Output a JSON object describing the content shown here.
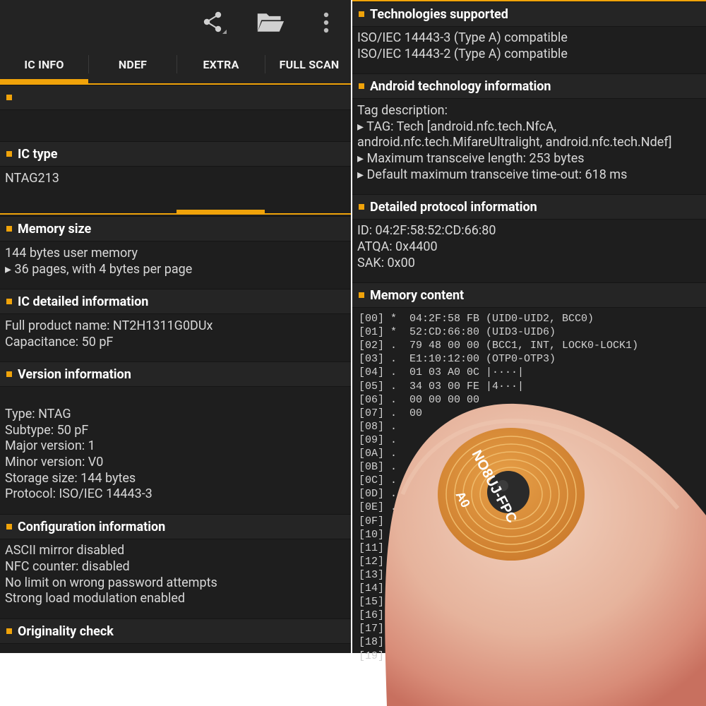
{
  "toolbar": {
    "icons": [
      "share-icon",
      "folder-open-icon",
      "more-vert-icon"
    ]
  },
  "tabs": [
    "IC INFO",
    "NDEF",
    "EXTRA",
    "FULL SCAN"
  ],
  "left_sections": [
    {
      "title": "",
      "lines": []
    },
    {
      "title": "IC type",
      "lines": [
        "NTAG213"
      ]
    },
    {
      "title": "Memory size",
      "lines": [
        "144 bytes user memory",
        "▸ 36 pages, with 4 bytes per page"
      ]
    },
    {
      "title": "IC detailed information",
      "lines": [
        "Full product name: NT2H1311G0DUx",
        "Capacitance: 50 pF"
      ]
    },
    {
      "title": "Version information",
      "lines": [
        "Type: NTAG",
        "Subtype: 50 pF",
        "Major version: 1",
        "Minor version: V0",
        "Storage size: 144 bytes",
        "Protocol: ISO/IEC 14443-3"
      ]
    },
    {
      "title": "Configuration information",
      "lines": [
        "ASCII mirror disabled",
        "NFC counter: disabled",
        "No limit on wrong password attempts",
        "Strong load modulation enabled"
      ]
    },
    {
      "title": "Originality check",
      "lines": []
    }
  ],
  "right_sections": [
    {
      "title": "Technologies supported",
      "lines": [
        "ISO/IEC 14443-3 (Type A) compatible",
        "ISO/IEC 14443-2 (Type A) compatible"
      ]
    },
    {
      "title": "Android technology information",
      "lines": [
        "Tag description:",
        "▸ TAG: Tech [android.nfc.tech.NfcA,",
        "android.nfc.tech.MifareUltralight, android.nfc.tech.Ndef]",
        "▸ Maximum transceive length: 253 bytes",
        "▸ Default maximum transceive time-out: 618 ms"
      ]
    },
    {
      "title": "Detailed protocol information",
      "lines": [
        "ID: 04:2F:58:52:CD:66:80",
        "ATQA: 0x4400",
        "SAK: 0x00"
      ]
    },
    {
      "title": "Memory content",
      "lines": []
    }
  ],
  "memory_lines": [
    "[00] *  04:2F:58 FB (UID0-UID2, BCC0)",
    "[01] *  52:CD:66:80 (UID3-UID6)",
    "[02] .  79 48 00 00 (BCC1, INT, LOCK0-LOCK1)",
    "[03] .  E1:10:12:00 (OTP0-OTP3)",
    "[04] .  01 03 A0 0C |····|",
    "[05] .  34 03 00 FE |4···|",
    "[06] .  00 00 00 00",
    "[07] .  00",
    "[08] .",
    "[09] .",
    "[0A] .",
    "[0B] .",
    "[0C] .",
    "[0D] .",
    "[0E] .",
    "[0F] .",
    "[10] .",
    "[11] .",
    "[12] .",
    "[13] .  0",
    "[14] .  00",
    "[15] .  00 00",
    "[16] .  00 00",
    "[17] .  00 00 00",
    "[18] .  00 00 00",
    "[19] .  00 00 00 00"
  ],
  "chip_text": [
    "NO8UJ-FPC",
    "A0"
  ],
  "colors": {
    "accent": "#f0a30a",
    "background": "#1e1e1e",
    "header": "#252525",
    "text": "#d8d8d8"
  }
}
